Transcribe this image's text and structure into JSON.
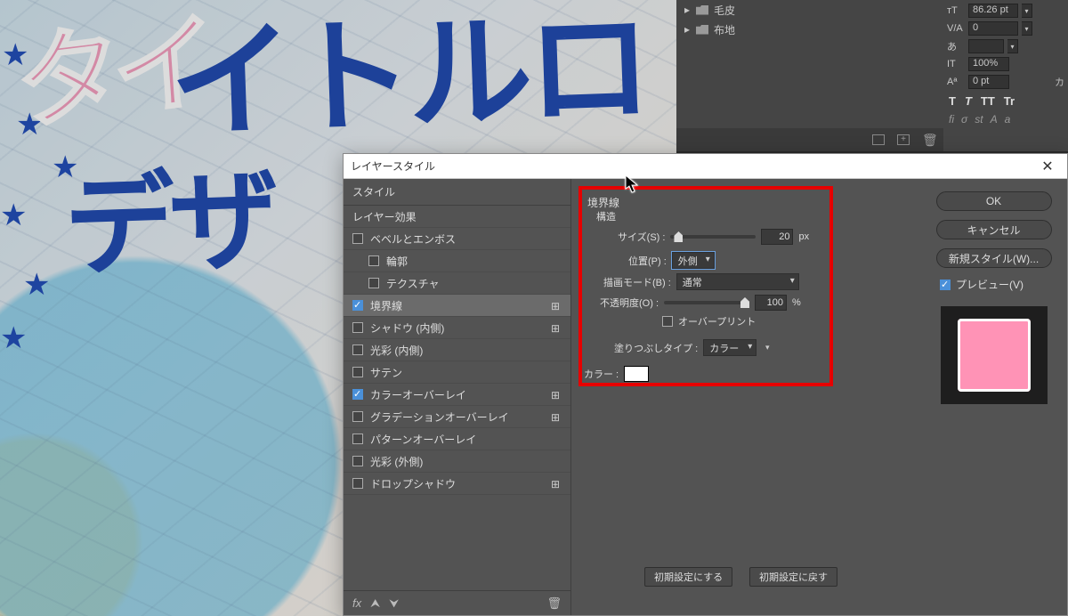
{
  "canvas": {
    "word1": "タイ",
    "word2": "イトルロ",
    "word3": "デザ"
  },
  "brush_panel": {
    "items": [
      "毛皮",
      "布地"
    ]
  },
  "char_panel": {
    "font_size": "86.26 pt",
    "kerning": "0",
    "tracking_icon": "",
    "scale_v": "100%",
    "baseline": "0 pt",
    "ka": "カ",
    "aa_labels": [
      "T",
      "T",
      "TT",
      "Tr"
    ],
    "ot_labels": [
      "fi",
      "σ",
      "st",
      "A",
      "a"
    ]
  },
  "dialog": {
    "title": "レイヤースタイル",
    "styles_header": "スタイル",
    "blending_options": "レイヤー効果",
    "effects": {
      "bevel": "ベベルとエンボス",
      "contour": "輪郭",
      "texture": "テクスチャ",
      "stroke": "境界線",
      "inner_shadow": "シャドウ (内側)",
      "inner_glow": "光彩 (内側)",
      "satin": "サテン",
      "color_overlay": "カラーオーバーレイ",
      "gradient_overlay": "グラデーションオーバーレイ",
      "pattern_overlay": "パターンオーバーレイ",
      "outer_glow": "光彩 (外側)",
      "drop_shadow": "ドロップシャドウ"
    },
    "fx_label": "fx",
    "stroke_settings": {
      "group": "境界線",
      "structure": "構造",
      "size_label": "サイズ(S) :",
      "size_value": "20",
      "size_unit": "px",
      "position_label": "位置(P) :",
      "position_value": "外側",
      "blend_label": "描画モード(B) :",
      "blend_value": "通常",
      "opacity_label": "不透明度(O) :",
      "opacity_value": "100",
      "opacity_unit": "%",
      "overprint_label": "オーバープリント",
      "filltype_label": "塗りつぶしタイプ :",
      "filltype_value": "カラー",
      "color_label": "カラー :"
    },
    "reset_buttons": {
      "make_default": "初期設定にする",
      "reset_default": "初期設定に戻す"
    },
    "right": {
      "ok": "OK",
      "cancel": "キャンセル",
      "new_style": "新規スタイル(W)...",
      "preview": "プレビュー(V)"
    }
  }
}
